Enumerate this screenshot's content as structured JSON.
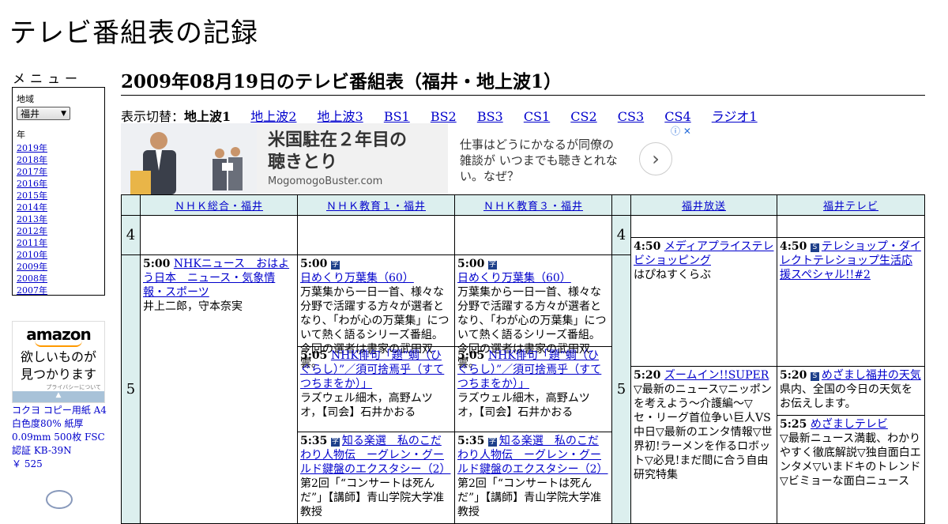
{
  "site_title": "テレビ番組表の記録",
  "menu": {
    "label": "メニュー",
    "region_label": "地域",
    "region_selected": "福井",
    "year_label": "年",
    "years": [
      "2019年",
      "2018年",
      "2017年",
      "2016年",
      "2015年",
      "2014年",
      "2013年",
      "2012年",
      "2011年",
      "2010年",
      "2009年",
      "2008年",
      "2007年"
    ]
  },
  "side_ad": {
    "brand": "amazon",
    "message_line1": "欲しいものが",
    "message_line2": "見つかります",
    "privacy": "プライバシーについて"
  },
  "product": {
    "name": "コクヨ コピー用紙 A4 白色度80% 紙厚 0.09mm 500枚 FSC認証 KB-39N",
    "price": "￥ 525"
  },
  "page_heading": "2009年08月19日のテレビ番組表（福井・地上波1）",
  "switcher": {
    "label": "表示切替：",
    "current": "地上波1",
    "links": [
      "地上波2",
      "地上波3",
      "BS1",
      "BS2",
      "BS3",
      "CS1",
      "CS2",
      "CS3",
      "CS4",
      "ラジオ1"
    ]
  },
  "banner_ad": {
    "headline_line1": "米国駐在２年目の",
    "headline_line2": "聴きとり",
    "domain": "MogomogoBuster.com",
    "body": "仕事はどうにかなるが同僚の雑談が いつまでも聴きとれない。なぜ？",
    "next": "›",
    "choice": "ⓘ ✕"
  },
  "channels": [
    "ＮＨＫ総合・福井",
    "ＮＨＫ教育１・福井",
    "ＮＨＫ教育３・福井",
    "福井放送",
    "福井テレビ"
  ],
  "hours": [
    "4",
    "5"
  ],
  "programs": {
    "nhk_g": [
      {
        "time": "5:00",
        "title": "NHKニュース　おはよう日本　ニュース・気象情報・スポーツ",
        "desc": "井上二郎，守本奈実"
      }
    ],
    "nhk_e1": [
      {
        "time": "5:00",
        "icon": "字",
        "title": "日めくり万葉集（60）",
        "desc": "万葉集から一日一首、様々な分野で活躍する方々が選者となり、「わが心の万葉集」について熱く語るシリーズ番組。今回の選者は書家の武田双雲。"
      },
      {
        "time": "5:05",
        "title": "NHK俳句「題“蜩（ひぐらし）”／須可捨焉乎（すてつちまをか）」",
        "desc": "ラズウェル細木，高野ムツオ，【司会】石井かおる"
      },
      {
        "time": "5:35",
        "icon": "字",
        "title": "知る楽選　私のこだわり人物伝　ーグレン・グールド鍵盤のエクスタシー（2）",
        "desc": "第2回「“コンサートは死んだ”」【講師】青山学院大学准教授"
      }
    ],
    "nhk_e3": [
      {
        "time": "5:00",
        "icon": "字",
        "title": "日めくり万葉集（60）",
        "desc": "万葉集から一日一首、様々な分野で活躍する方々が選者となり、「わが心の万葉集」について熱く語るシリーズ番組。今回の選者は書家の武田双雲。"
      },
      {
        "time": "5:05",
        "title": "NHK俳句「題“蜩（ひぐらし）”／須可捨焉乎（すてつちまをか）」",
        "desc": "ラズウェル細木，高野ムツオ，【司会】石井かおる"
      },
      {
        "time": "5:35",
        "icon": "字",
        "title": "知る楽選　私のこだわり人物伝　ーグレン・グールド鍵盤のエクスタシー（2）",
        "desc": "第2回「“コンサートは死んだ”」【講師】青山学院大学准教授"
      }
    ],
    "fbc": [
      {
        "time": "4:50",
        "title": "メディアプライステレビショッピング",
        "desc": "はぴねすくらぶ"
      },
      {
        "time": "5:20",
        "title": "ズームイン!!SUPER",
        "desc": "▽最新のニュース▽ニッポンを考えよう～介護編～▽セ・リーグ首位争い巨人VS中日▽最新のエンタ情報▽世界初!ラーメンを作るロボット▽必見!まだ間に合う自由研究特集"
      }
    ],
    "fti": [
      {
        "time": "4:50",
        "icon": "S",
        "title": "テレショップ・ダイレクトテレショップ生活応援スペシャル!!#2",
        "desc": ""
      },
      {
        "time": "5:20",
        "icon": "S",
        "title": "めざまし福井の天気",
        "desc": "県内、全国の今日の天気をお伝えします。"
      },
      {
        "time": "5:25",
        "title": "めざましテレビ",
        "desc": "▽最新ニュース満載、わかりやすく徹底解説▽独自面白エンタメ▽いまドキのトレンド▽ビミョーな面白ニュース"
      }
    ]
  }
}
